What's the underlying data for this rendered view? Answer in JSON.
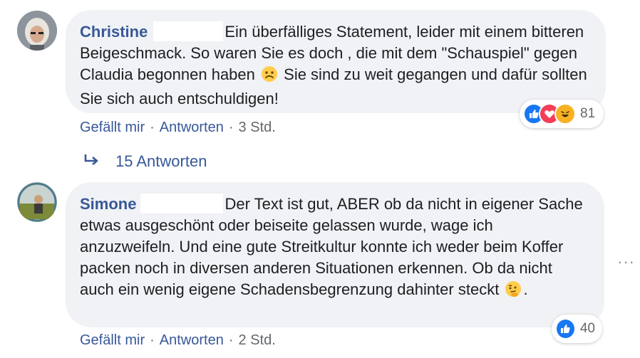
{
  "comments": [
    {
      "author": "Christine",
      "text": "Ein überfälliges Statement, leider mit einem bitteren Beigeschmack. So waren Sie es doch , die mit dem \"Schauspiel\" gegen Claudia begonnen haben",
      "text_after_emoji": "Sie sind zu weit gegangen und dafür sollten Sie sich auch entschuldigen!",
      "emoji": "frowning-face",
      "actions": {
        "like": "Gefällt mir",
        "reply": "Antworten",
        "time": "3 Std."
      },
      "reactions": {
        "types": [
          "like",
          "love",
          "haha"
        ],
        "count": "81"
      },
      "replies_label": "15 Antworten"
    },
    {
      "author": "Simone",
      "text": "Der Text ist gut, ABER ob da nicht in eigener Sache etwas ausgeschönt oder beiseite gelassen wurde, wage ich anzuzweifeln. Und eine gute Streitkultur konnte ich weder beim Koffer packen noch in diversen anderen Situationen erkennen. Ob da nicht auch ein wenig eigene Schadensbegrenzung dahinter steckt",
      "text_end": ".",
      "emoji": "thinking-face",
      "actions": {
        "like": "Gefällt mir",
        "reply": "Antworten",
        "time": "2 Std."
      },
      "reactions": {
        "types": [
          "like"
        ],
        "count": "40"
      }
    }
  ],
  "separator": "·",
  "more_menu": "···",
  "colors": {
    "link": "#385898",
    "bubble": "#f0f2f5",
    "meta": "#65676b",
    "like": "#1877f2",
    "love": "#f33e58",
    "haha": "#f7b125"
  }
}
